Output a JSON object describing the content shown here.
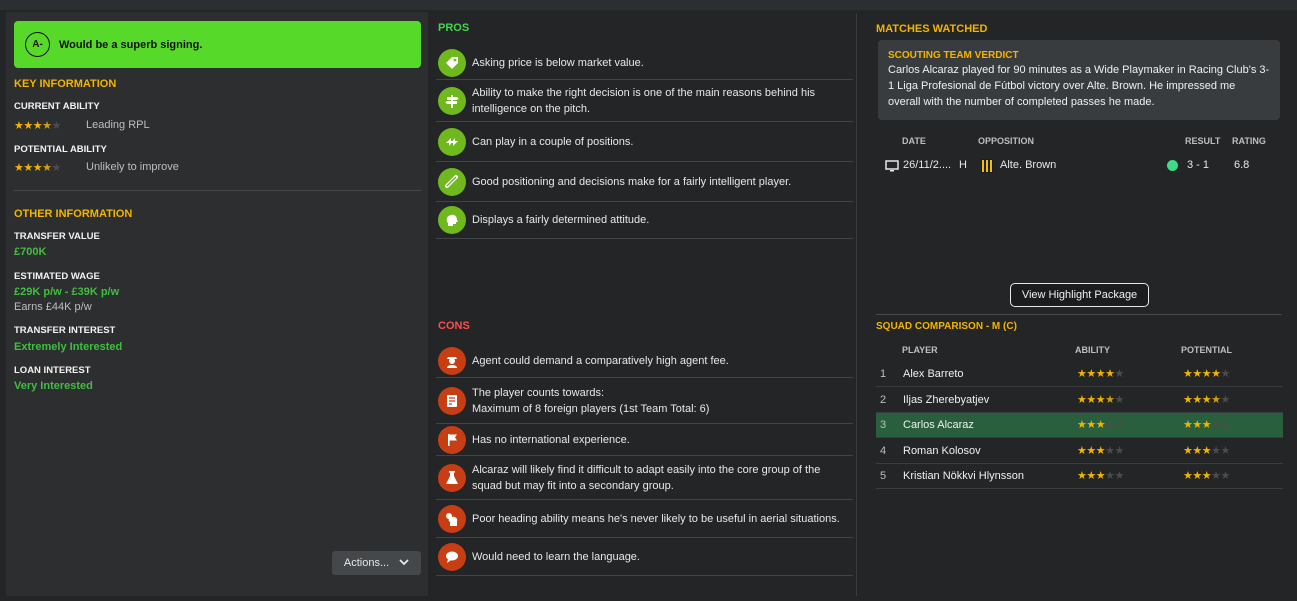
{
  "verdict": {
    "grade": "A-",
    "text": "Would be a superb signing."
  },
  "key_info": {
    "title": "KEY INFORMATION",
    "current_ability_label": "CURRENT ABILITY",
    "current_ability_stars": 3.5,
    "current_ability_desc": "Leading RPL",
    "potential_ability_label": "POTENTIAL ABILITY",
    "potential_ability_stars": 3.5,
    "potential_ability_desc": "Unlikely to improve"
  },
  "other_info": {
    "title": "OTHER INFORMATION",
    "transfer_value_label": "TRANSFER VALUE",
    "transfer_value": "£700K",
    "estimated_wage_label": "ESTIMATED WAGE",
    "estimated_wage": "£29K p/w - £39K p/w",
    "earns": "Earns £44K p/w",
    "transfer_interest_label": "TRANSFER INTEREST",
    "transfer_interest": "Extremely Interested",
    "loan_interest_label": "LOAN INTEREST",
    "loan_interest": "Very Interested"
  },
  "actions_label": "Actions...",
  "pros": {
    "title": "PROS",
    "items": [
      {
        "icon": "price-tag-icon",
        "text": "Asking price is below market value."
      },
      {
        "icon": "signpost-icon",
        "text": "Ability to make the right decision is one of the main reasons behind his intelligence on the pitch."
      },
      {
        "icon": "swap-arrows-icon",
        "text": "Can play in a couple of positions."
      },
      {
        "icon": "tactics-board-icon",
        "text": "Good positioning and decisions make for a fairly intelligent player."
      },
      {
        "icon": "head-icon",
        "text": "Displays a fairly determined attitude."
      }
    ]
  },
  "cons": {
    "title": "CONS",
    "items": [
      {
        "icon": "agent-icon",
        "text": "Agent could demand a comparatively high agent fee."
      },
      {
        "icon": "registration-icon",
        "text": "The player counts towards:\nMaximum of 8 foreign players (1st Team Total: 6)"
      },
      {
        "icon": "flag-icon",
        "text": "Has no international experience."
      },
      {
        "icon": "flask-icon",
        "text": "Alcaraz will likely find it difficult to adapt easily into the core group of the squad but may fit into a secondary group."
      },
      {
        "icon": "heading-icon",
        "text": "Poor heading ability means he's never likely to be useful in aerial situations."
      },
      {
        "icon": "speech-bubble-icon",
        "text": "Would need to learn the language."
      }
    ]
  },
  "matches": {
    "title": "MATCHES WATCHED",
    "verdict_title": "SCOUTING TEAM VERDICT",
    "verdict_text": "Carlos Alcaraz played for 90 minutes as a Wide Playmaker in Racing Club's 3-1 Liga Profesional de Fútbol victory over Alte. Brown. He impressed me overall with the number of completed passes he made.",
    "headers": {
      "date": "DATE",
      "opposition": "OPPOSITION",
      "result": "RESULT",
      "rating": "RATING"
    },
    "row": {
      "date": "26/11/2....",
      "venue": "H",
      "opposition": "Alte. Brown",
      "result": "3 - 1",
      "rating": "6.8"
    },
    "highlight_button": "View Highlight Package"
  },
  "squad": {
    "title": "SQUAD COMPARISON - M (C)",
    "headers": {
      "player": "PLAYER",
      "ability": "ABILITY",
      "potential": "POTENTIAL"
    },
    "rows": [
      {
        "num": "1",
        "name": "Alex Barreto",
        "ability": 4,
        "potential": 4,
        "selected": false
      },
      {
        "num": "2",
        "name": "Iljas Zherebyatjev",
        "ability": 3.5,
        "potential": 3.5,
        "selected": false
      },
      {
        "num": "3",
        "name": "Carlos Alcaraz",
        "ability": 3,
        "potential": 3,
        "selected": true
      },
      {
        "num": "4",
        "name": "Roman Kolosov",
        "ability": 3,
        "potential": 3,
        "selected": false
      },
      {
        "num": "5",
        "name": "Kristian Nökkvi Hlynsson",
        "ability": 3,
        "potential": 3,
        "selected": false
      }
    ]
  },
  "colors": {
    "accent": "#f2b400",
    "verdict_bg": "#57d92a",
    "pro": "#6fb81e",
    "con": "#c83e14",
    "selected_row": "#2a5f3d"
  }
}
